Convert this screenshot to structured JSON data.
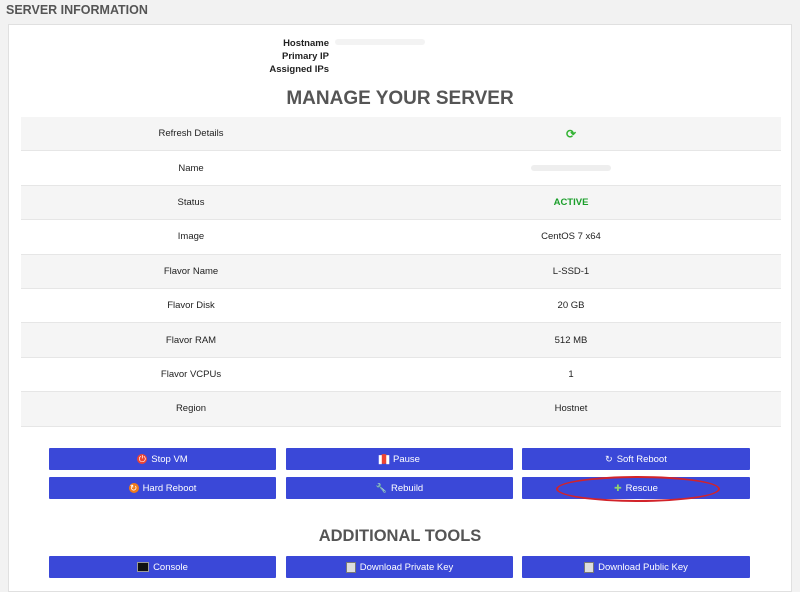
{
  "section_title": "SERVER INFORMATION",
  "server_info": {
    "hostname_label": "Hostname",
    "primary_ip_label": "Primary IP",
    "assigned_ips_label": "Assigned IPs"
  },
  "manage_title": "MANAGE YOUR SERVER",
  "details": [
    {
      "label": "Refresh Details",
      "value": ""
    },
    {
      "label": "Name",
      "value": ""
    },
    {
      "label": "Status",
      "value": "ACTIVE"
    },
    {
      "label": "Image",
      "value": "CentOS 7 x64"
    },
    {
      "label": "Flavor Name",
      "value": "L-SSD-1"
    },
    {
      "label": "Flavor Disk",
      "value": "20 GB"
    },
    {
      "label": "Flavor RAM",
      "value": "512 MB"
    },
    {
      "label": "Flavor VCPUs",
      "value": "1"
    },
    {
      "label": "Region",
      "value": "Hostnet"
    }
  ],
  "actions": {
    "stop_vm": "Stop VM",
    "pause": "Pause",
    "soft_reboot": "Soft Reboot",
    "hard_reboot": "Hard Reboot",
    "rebuild": "Rebuild",
    "rescue": "Rescue"
  },
  "tools_title": "ADDITIONAL TOOLS",
  "tools": {
    "console": "Console",
    "download_private_key": "Download Private Key",
    "download_public_key": "Download Public Key"
  },
  "colors": {
    "button_bg": "#3a48d8",
    "status_active": "#1a9e2a",
    "highlight_ellipse": "#d2232a"
  }
}
